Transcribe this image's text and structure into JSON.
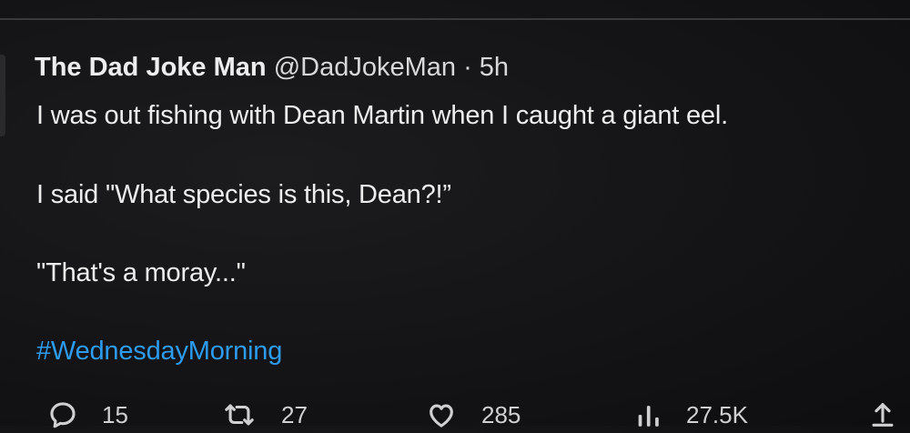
{
  "tweet": {
    "display_name": "The Dad Joke Man",
    "handle": "@DadJokeMan",
    "separator": "·",
    "time": "5h",
    "lines": [
      "I was out fishing with Dean Martin when I caught a giant eel.",
      "I said \"What species is this, Dean?!”",
      "\"That's a moray...\""
    ],
    "hashtag": "#WednesdayMorning"
  },
  "actions": {
    "reply": {
      "icon": "reply-icon",
      "count": "15"
    },
    "retweet": {
      "icon": "retweet-icon",
      "count": "27"
    },
    "like": {
      "icon": "heart-icon",
      "count": "285"
    },
    "views": {
      "icon": "analytics-icon",
      "count": "27.5K"
    },
    "share": {
      "icon": "share-icon"
    }
  },
  "colors": {
    "background": "#141416",
    "text": "#ededee",
    "hashtag": "#2c9bf0",
    "icon": "#d0d0d3"
  }
}
